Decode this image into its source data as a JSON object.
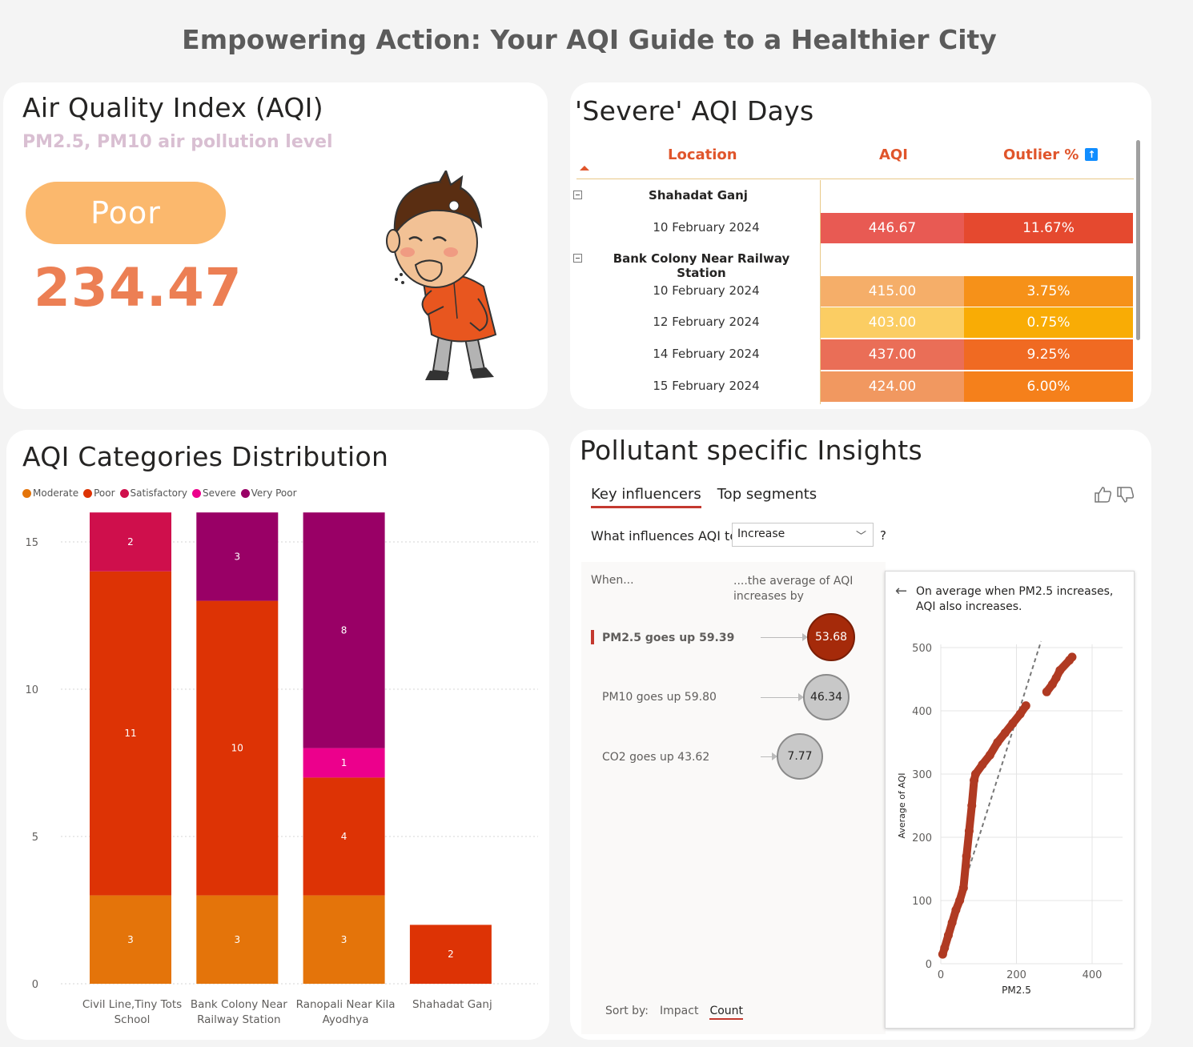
{
  "page_title": "Empowering Action: Your AQI Guide to a Healthier City",
  "aqi_card": {
    "title": "Air Quality Index (AQI)",
    "subtitle": "PM2.5, PM10 air pollution level",
    "category": "Poor",
    "value": "234.47",
    "illustration": "coughing-boy-illustration"
  },
  "severe_card": {
    "title": "'Severe' AQI Days",
    "columns": [
      "Location",
      "AQI",
      "Outlier %"
    ],
    "info_icon": "up-arrow-info-icon",
    "groups": [
      {
        "location": "Shahadat Ganj",
        "rows": [
          {
            "date": "10 February 2024",
            "aqi": "446.67",
            "outlier": "11.67%",
            "aqi_color": "#e85a53",
            "outlier_color": "#e5492f"
          }
        ]
      },
      {
        "location": "Bank Colony Near Railway Station",
        "rows": [
          {
            "date": "10 February 2024",
            "aqi": "415.00",
            "outlier": "3.75%",
            "aqi_color": "#f5ae69",
            "outlier_color": "#f69119"
          },
          {
            "date": "12 February 2024",
            "aqi": "403.00",
            "outlier": "0.75%",
            "aqi_color": "#fbcd63",
            "outlier_color": "#f9ac05"
          },
          {
            "date": "14 February 2024",
            "aqi": "437.00",
            "outlier": "9.25%",
            "aqi_color": "#ea6e57",
            "outlier_color": "#f06a22"
          },
          {
            "date": "15 February 2024",
            "aqi": "424.00",
            "outlier": "6.00%",
            "aqi_color": "#f19860",
            "outlier_color": "#f5801b"
          }
        ]
      }
    ]
  },
  "dist_card": {
    "title": "AQI Categories Distribution"
  },
  "chart_data": {
    "type": "bar",
    "stacked": true,
    "categories": [
      "Civil Line,Tiny Tots School",
      "Bank Colony Near Railway Station",
      "Ranopali Near Kila Ayodhya",
      "Shahadat Ganj"
    ],
    "category_lines": [
      [
        "Civil Line,Tiny Tots",
        "School"
      ],
      [
        "Bank Colony Near",
        "Railway Station"
      ],
      [
        "Ranopali Near Kila",
        "Ayodhya"
      ],
      [
        "Shahadat Ganj"
      ]
    ],
    "series": [
      {
        "name": "Moderate",
        "color": "#e4740a",
        "values": [
          3,
          3,
          3,
          0
        ]
      },
      {
        "name": "Poor",
        "color": "#dd3305",
        "values": [
          11,
          10,
          4,
          2
        ]
      },
      {
        "name": "Satisfactory",
        "color": "#cf0f4c",
        "values": [
          2,
          0,
          0,
          0
        ]
      },
      {
        "name": "Severe",
        "color": "#ec008c",
        "values": [
          0,
          0,
          1,
          0
        ]
      },
      {
        "name": "Very Poor",
        "color": "#990066",
        "values": [
          0,
          3,
          8,
          0
        ]
      }
    ],
    "ylim": [
      0,
      16
    ],
    "yticks": [
      0,
      5,
      10,
      15
    ],
    "grid": true,
    "legend": "top-left"
  },
  "pollutant_card": {
    "title": "Pollutant specific Insights",
    "tabs": [
      "Key influencers",
      "Top segments"
    ],
    "question": "What influences AQI to",
    "dropdown_value": "Increase",
    "qmark": "?",
    "when_label": "When...",
    "avg_label": "....the average of AQI increases by",
    "influencers": [
      {
        "label": "PM2.5 goes up 59.39",
        "value": "53.68"
      },
      {
        "label": "PM10 goes up 59.80",
        "value": "46.34"
      },
      {
        "label": "CO2 goes up 43.62",
        "value": "7.77"
      }
    ],
    "sort_label": "Sort by:",
    "sort_options": [
      "Impact",
      "Count"
    ],
    "detail_text": "On average when PM2.5 increases, AQI also increases.",
    "scatter": {
      "xlabel": "PM2.5",
      "ylabel": "Average of AQI",
      "xticks": [
        0,
        200,
        400
      ],
      "yticks": [
        0,
        100,
        200,
        300,
        400,
        500
      ],
      "xlim": [
        0,
        400
      ],
      "ylim": [
        0,
        500
      ],
      "trend": [
        [
          0,
          10
        ],
        [
          265,
          510
        ]
      ],
      "points": [
        [
          5,
          15
        ],
        [
          10,
          25
        ],
        [
          20,
          45
        ],
        [
          30,
          65
        ],
        [
          40,
          85
        ],
        [
          50,
          100
        ],
        [
          60,
          120
        ],
        [
          68,
          170
        ],
        [
          75,
          210
        ],
        [
          82,
          250
        ],
        [
          88,
          290
        ],
        [
          92,
          300
        ],
        [
          110,
          315
        ],
        [
          130,
          330
        ],
        [
          150,
          350
        ],
        [
          170,
          365
        ],
        [
          190,
          380
        ],
        [
          210,
          395
        ],
        [
          225,
          408
        ],
        [
          280,
          430
        ],
        [
          295,
          442
        ],
        [
          305,
          452
        ],
        [
          315,
          464
        ],
        [
          340,
          480
        ],
        [
          347,
          485
        ]
      ]
    }
  }
}
